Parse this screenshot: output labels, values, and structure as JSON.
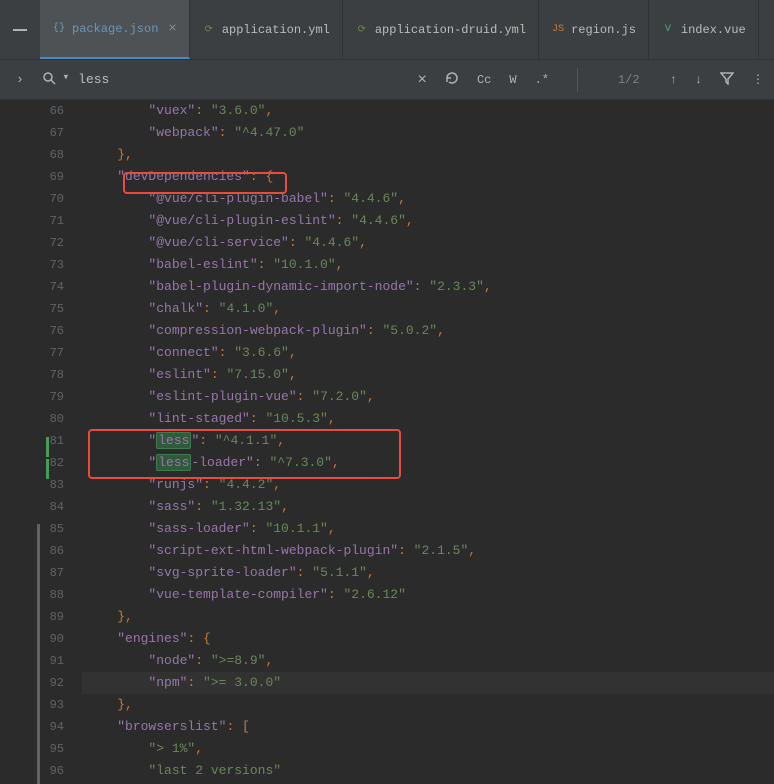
{
  "tabs": [
    {
      "icon": "{}",
      "iconColor": "#6a9fb5",
      "label": "package.json",
      "active": true,
      "closeable": true
    },
    {
      "icon": "⟳",
      "iconColor": "#6a8759",
      "label": "application.yml",
      "active": false,
      "closeable": false
    },
    {
      "icon": "⟳",
      "iconColor": "#6a8759",
      "label": "application-druid.yml",
      "active": false,
      "closeable": false
    },
    {
      "icon": "JS",
      "iconColor": "#cc7832",
      "label": "region.js",
      "active": false,
      "closeable": false
    },
    {
      "icon": "V",
      "iconColor": "#41b883",
      "label": "index.vue",
      "active": false,
      "closeable": false
    }
  ],
  "search": {
    "query": "less",
    "clear": "×",
    "recycle": "↻",
    "cc": "Cc",
    "w": "W",
    "regex": ".*",
    "matchCount": "1/2"
  },
  "lines": [
    {
      "num": "66",
      "indent": 8,
      "key": "vuex",
      "val": "3.6.0",
      "trail": ","
    },
    {
      "num": "67",
      "indent": 8,
      "key": "webpack",
      "val": "^4.47.0",
      "trail": ""
    },
    {
      "num": "68",
      "indent": 4,
      "raw": "},"
    },
    {
      "num": "69",
      "indent": 4,
      "key": "devDependencies",
      "val": null,
      "trail": ": {"
    },
    {
      "num": "70",
      "indent": 8,
      "key": "@vue/cli-plugin-babel",
      "val": "4.4.6",
      "trail": ","
    },
    {
      "num": "71",
      "indent": 8,
      "key": "@vue/cli-plugin-eslint",
      "val": "4.4.6",
      "trail": ","
    },
    {
      "num": "72",
      "indent": 8,
      "key": "@vue/cli-service",
      "val": "4.4.6",
      "trail": ","
    },
    {
      "num": "73",
      "indent": 8,
      "key": "babel-eslint",
      "val": "10.1.0",
      "trail": ","
    },
    {
      "num": "74",
      "indent": 8,
      "key": "babel-plugin-dynamic-import-node",
      "val": "2.3.3",
      "trail": ","
    },
    {
      "num": "75",
      "indent": 8,
      "key": "chalk",
      "val": "4.1.0",
      "trail": ","
    },
    {
      "num": "76",
      "indent": 8,
      "key": "compression-webpack-plugin",
      "val": "5.0.2",
      "trail": ","
    },
    {
      "num": "77",
      "indent": 8,
      "key": "connect",
      "val": "3.6.6",
      "trail": ","
    },
    {
      "num": "78",
      "indent": 8,
      "key": "eslint",
      "val": "7.15.0",
      "trail": ","
    },
    {
      "num": "79",
      "indent": 8,
      "key": "eslint-plugin-vue",
      "val": "7.2.0",
      "trail": ","
    },
    {
      "num": "80",
      "indent": 8,
      "key": "lint-staged",
      "val": "10.5.3",
      "trail": ","
    },
    {
      "num": "81",
      "indent": 8,
      "key": "less",
      "highlight": "less",
      "val": "^4.1.1",
      "trail": ",",
      "current": true
    },
    {
      "num": "82",
      "indent": 8,
      "key": "less-loader",
      "highlight": "less",
      "keyAfter": "-loader",
      "val": "^7.3.0",
      "trail": ","
    },
    {
      "num": "83",
      "indent": 8,
      "key": "runjs",
      "val": "4.4.2",
      "trail": ","
    },
    {
      "num": "84",
      "indent": 8,
      "key": "sass",
      "val": "1.32.13",
      "trail": ","
    },
    {
      "num": "85",
      "indent": 8,
      "key": "sass-loader",
      "val": "10.1.1",
      "trail": ","
    },
    {
      "num": "86",
      "indent": 8,
      "key": "script-ext-html-webpack-plugin",
      "val": "2.1.5",
      "trail": ","
    },
    {
      "num": "87",
      "indent": 8,
      "key": "svg-sprite-loader",
      "val": "5.1.1",
      "trail": ","
    },
    {
      "num": "88",
      "indent": 8,
      "key": "vue-template-compiler",
      "val": "2.6.12",
      "trail": ""
    },
    {
      "num": "89",
      "indent": 4,
      "raw": "},"
    },
    {
      "num": "90",
      "indent": 4,
      "key": "engines",
      "val": null,
      "trail": ": {"
    },
    {
      "num": "91",
      "indent": 8,
      "key": "node",
      "val": ">=8.9",
      "trail": ","
    },
    {
      "num": "92",
      "indent": 8,
      "key": "npm",
      "val": ">= 3.0.0",
      "trail": "",
      "currentLine": true
    },
    {
      "num": "93",
      "indent": 4,
      "raw": "},"
    },
    {
      "num": "94",
      "indent": 4,
      "key": "browserslist",
      "val": null,
      "trail": ": ["
    },
    {
      "num": "95",
      "indent": 8,
      "onlyVal": "> 1%",
      "trail": ","
    },
    {
      "num": "96",
      "indent": 8,
      "onlyVal": "last 2 versions",
      "trail": ""
    }
  ]
}
